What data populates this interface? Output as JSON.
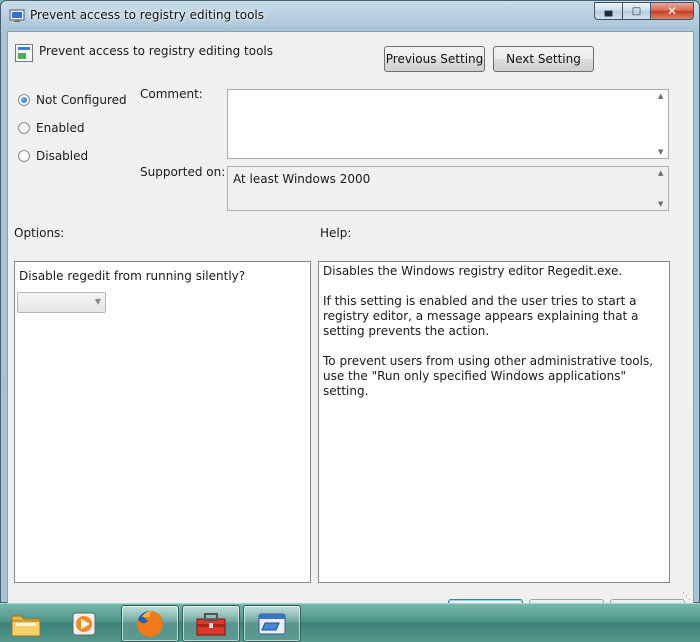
{
  "window": {
    "title": "Prevent access to registry editing tools"
  },
  "header": {
    "policy_title": "Prevent access to registry editing tools",
    "previous_label": "Previous Setting",
    "next_label": "Next Setting"
  },
  "state": {
    "options": [
      {
        "label": "Not Configured",
        "checked": true
      },
      {
        "label": "Enabled",
        "checked": false
      },
      {
        "label": "Disabled",
        "checked": false
      }
    ]
  },
  "comment": {
    "label": "Comment:",
    "value": ""
  },
  "supported": {
    "label": "Supported on:",
    "value": "At least Windows 2000"
  },
  "options_panel": {
    "label": "Options:",
    "field_label": "Disable regedit from running silently?",
    "combo_value": ""
  },
  "help_panel": {
    "label": "Help:",
    "paragraphs": [
      "Disables the Windows registry editor Regedit.exe.",
      "If this setting is enabled and the user tries to start a registry editor, a message appears explaining that a setting prevents the action.",
      "To prevent users from using other administrative tools, use the \"Run only specified Windows applications\" setting."
    ]
  },
  "taskbar": {
    "items": [
      {
        "icon": "folder-icon"
      },
      {
        "icon": "media-player-icon"
      },
      {
        "icon": "firefox-icon"
      },
      {
        "icon": "toolbox-icon"
      },
      {
        "icon": "window-app-icon"
      }
    ]
  },
  "colors": {
    "accent": "#1f5fb8",
    "taskbar": "#4f948a"
  }
}
